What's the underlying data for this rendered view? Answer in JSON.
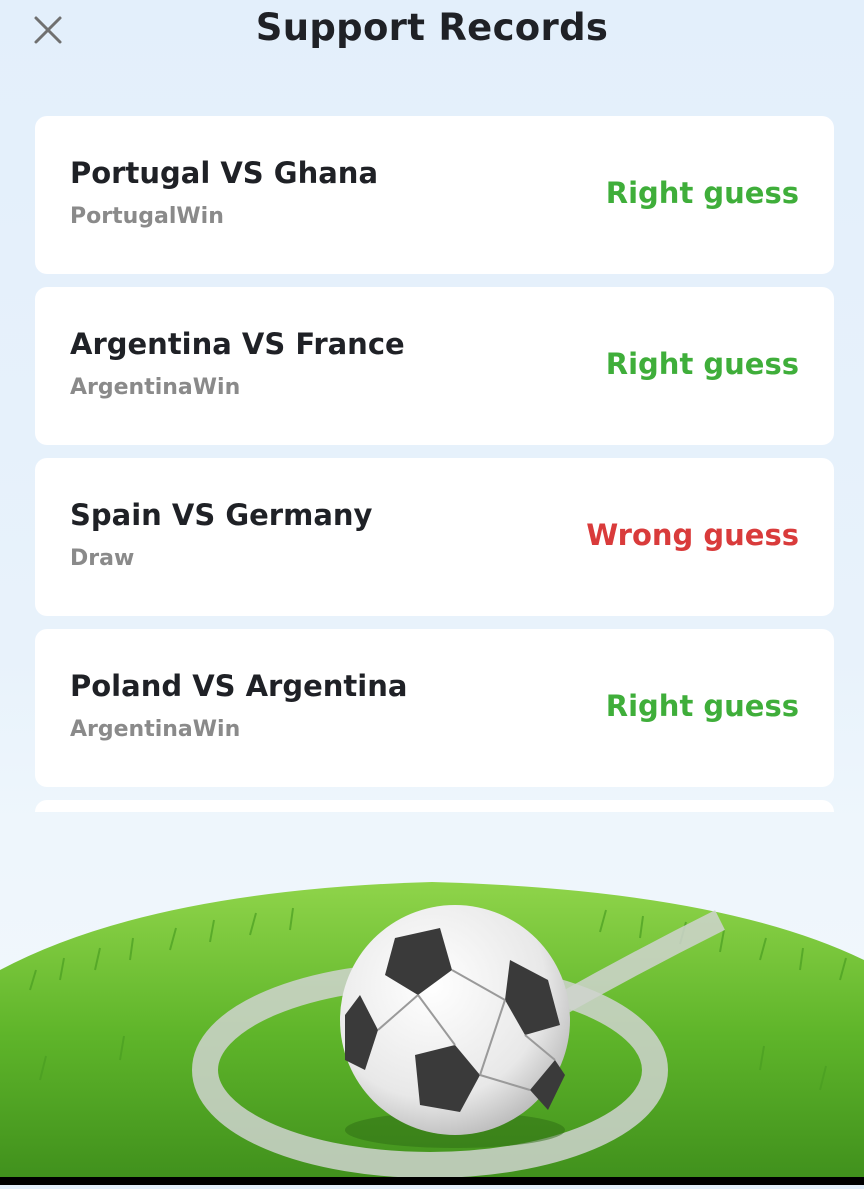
{
  "header": {
    "title": "Support Records",
    "close_icon": "close-icon"
  },
  "colors": {
    "right_guess": "#3fae3a",
    "wrong_guess": "#d93b3b",
    "card_bg": "#ffffff",
    "page_bg": "#e3effb"
  },
  "records": [
    {
      "match": "Portugal VS Ghana",
      "pick": "PortugalWin",
      "result": "Right guess",
      "status": "right"
    },
    {
      "match": "Argentina VS France",
      "pick": "ArgentinaWin",
      "result": "Right guess",
      "status": "right"
    },
    {
      "match": "Spain VS Germany",
      "pick": "Draw",
      "result": "Wrong guess",
      "status": "wrong"
    },
    {
      "match": "Poland VS Argentina",
      "pick": "ArgentinaWin",
      "result": "Right guess",
      "status": "right"
    }
  ],
  "illustration": "soccer-ball-on-grass"
}
